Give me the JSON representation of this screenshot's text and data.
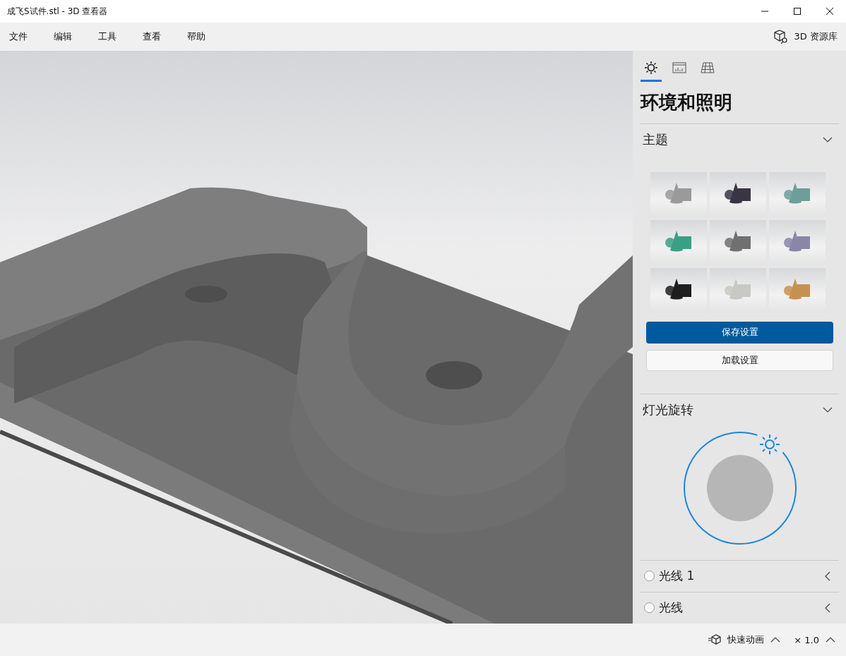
{
  "window": {
    "title": "成飞S试件.stl - 3D 查看器"
  },
  "menu": [
    "文件",
    "编辑",
    "工具",
    "查看",
    "帮助"
  ],
  "library_button": "3D 资源库",
  "panel": {
    "tabs": [
      {
        "kind": "lighting",
        "selected": true
      },
      {
        "kind": "stats",
        "selected": false
      },
      {
        "kind": "grid",
        "selected": false
      }
    ],
    "heading": "环境和照明",
    "theme_section": {
      "title": "主题",
      "expanded": true,
      "themes": [
        {
          "color": "#9a9a9a"
        },
        {
          "color": "#3a3545"
        },
        {
          "color": "#6e9e98"
        },
        {
          "color": "#3aa084"
        },
        {
          "color": "#707070"
        },
        {
          "color": "#8a86a8"
        },
        {
          "color": "#1e1e1e"
        },
        {
          "color": "#c8c8c4"
        },
        {
          "color": "#c89050"
        }
      ],
      "save_button": "保存设置",
      "load_button": "加载设置"
    },
    "rotation_section": {
      "title": "灯光旋转",
      "expanded": true
    },
    "lights": [
      {
        "label": "光线 1",
        "checked": false
      },
      {
        "label": "光线",
        "checked": false
      }
    ]
  },
  "status_bar": {
    "animation": "快速动画",
    "zoom": "× 1.0"
  }
}
